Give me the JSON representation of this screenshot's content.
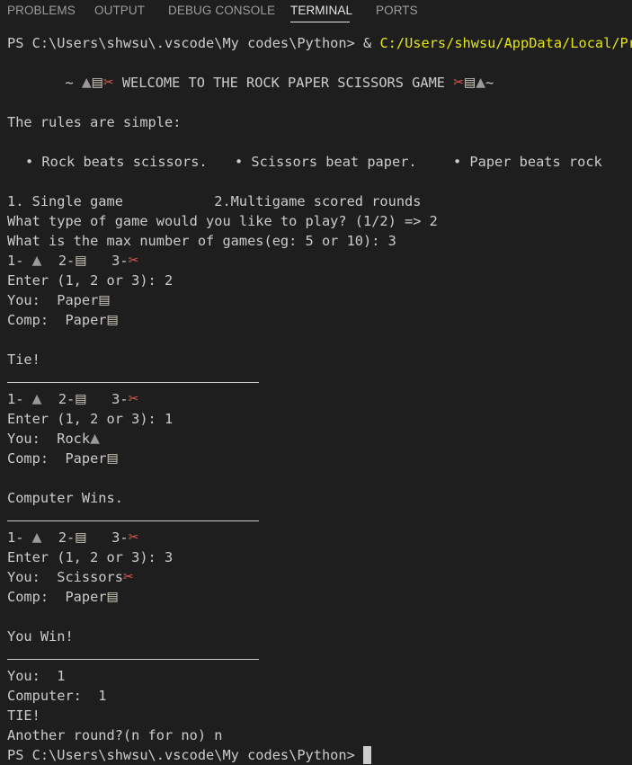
{
  "tabs": [
    {
      "label": "PROBLEMS"
    },
    {
      "label": "OUTPUT"
    },
    {
      "label": "DEBUG CONSOLE"
    },
    {
      "label": "TERMINAL"
    },
    {
      "label": "PORTS"
    }
  ],
  "terminal": {
    "prompt_path": "PS C:\\Users\\shwsu\\.vscode\\My codes\\Python>",
    "command_amp": " & ",
    "command_path": "C:/Users/shwsu/AppData/Local/Programs/Python/",
    "welcome_prefix": "~ ",
    "welcome_text": " WELCOME TO THE ROCK PAPER SCISSORS GAME ",
    "welcome_suffix": "~",
    "rules_title": "The rules are simple:",
    "rule_1": "• Rock beats scissors.",
    "rule_2": "• Scissors beat paper.",
    "rule_3": "• Paper beats rock",
    "menu": "1. Single game           2.Multigame scored rounds",
    "game_type_q": "What type of game would you like to play? (1/2) => 2",
    "max_games_q": "What is the max number of games(eg: 5 or 10): 3",
    "choice_1": "1- ",
    "choice_2": "  2-",
    "choice_3": "   3-",
    "enter_prompt_prefix": "Enter (1, 2 or 3): ",
    "you_label": "You:  ",
    "comp_label": "Comp:  ",
    "rounds": [
      {
        "enter": "2",
        "you": "Paper",
        "you_icon": "paper",
        "comp": "Paper",
        "comp_icon": "paper",
        "result": "Tie!"
      },
      {
        "enter": "1",
        "you": "Rock",
        "you_icon": "rock",
        "comp": "Paper",
        "comp_icon": "paper",
        "result": "Computer Wins."
      },
      {
        "enter": "3",
        "you": "Scissors",
        "you_icon": "scissors",
        "comp": "Paper",
        "comp_icon": "paper",
        "result": "You Win!"
      }
    ],
    "score_you": "You:  1",
    "score_comp": "Computer:  1",
    "final_result": "TIE!",
    "another_round": "Another round?(n for no) n",
    "final_prompt": "PS C:\\Users\\shwsu\\.vscode\\My codes\\Python>"
  },
  "icons": {
    "rock": "rock-icon",
    "paper": "paper-icon",
    "scissors": "scissors-icon"
  },
  "colors": {
    "background": "#1e1e1e",
    "text": "#cccccc",
    "command_path": "#e5e510",
    "active_tab": "#e7e7e7",
    "inactive_tab": "#9d9d9d"
  }
}
